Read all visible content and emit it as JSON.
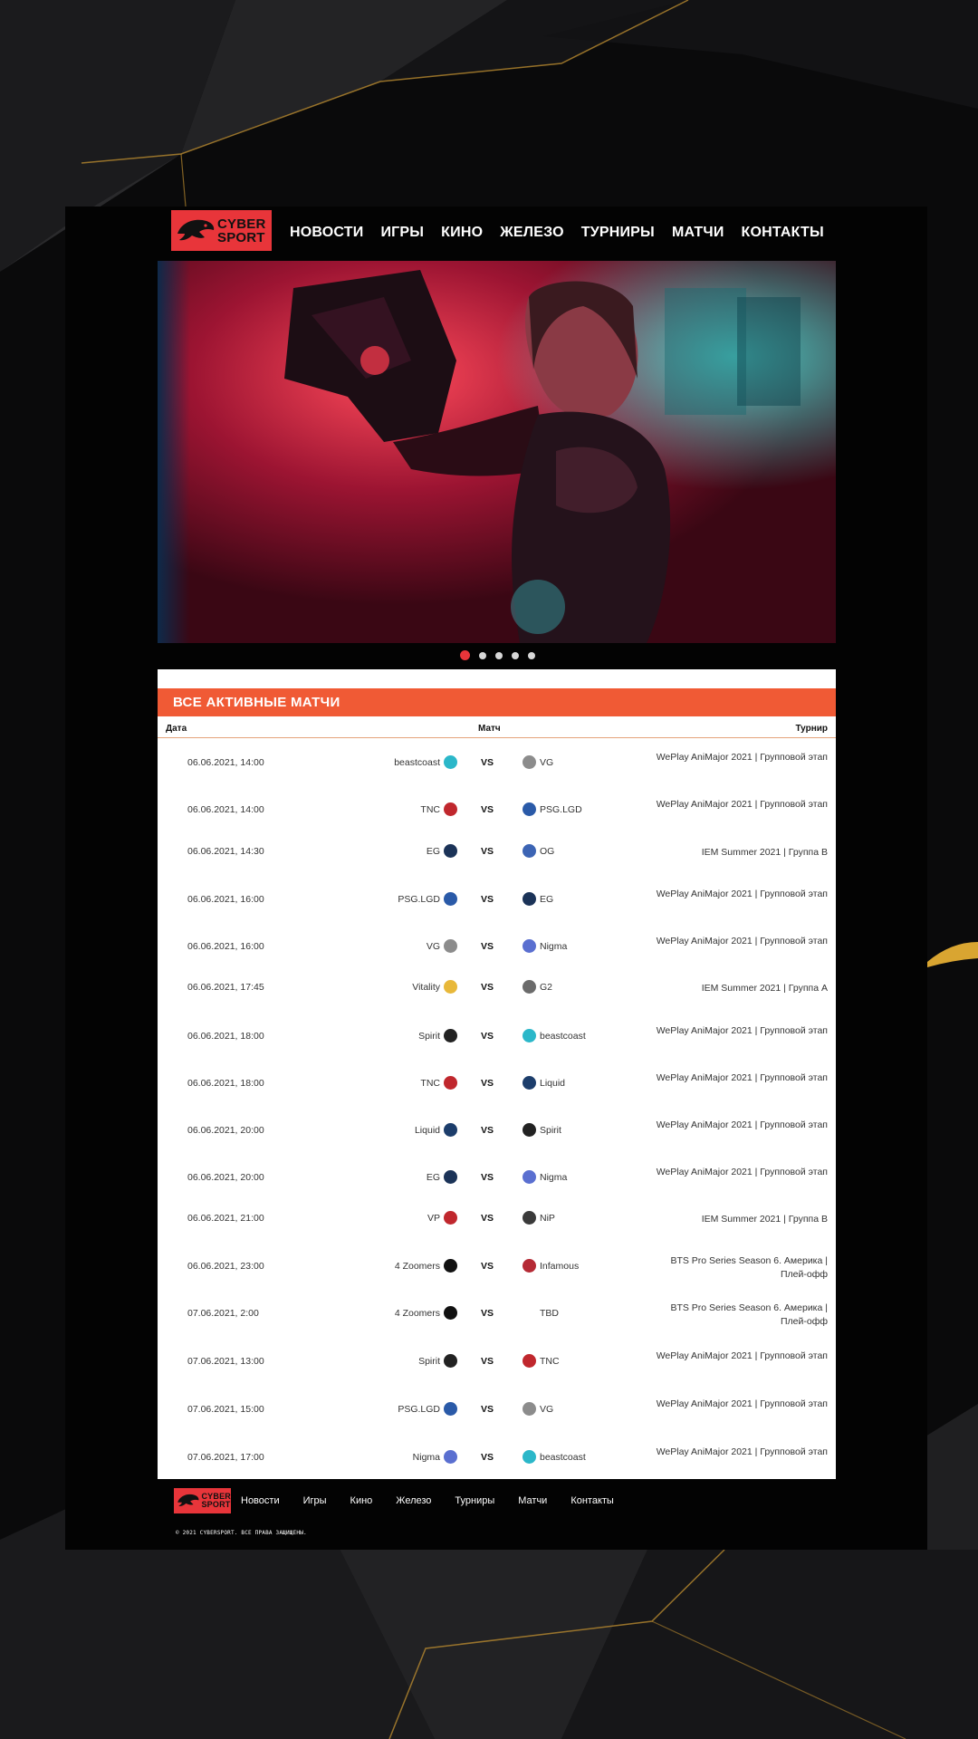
{
  "logo": {
    "line1": "CYBER",
    "line2": "SPORT"
  },
  "nav": [
    "НОВОСТИ",
    "ИГРЫ",
    "КИНО",
    "ЖЕЛЕЗО",
    "ТУРНИРЫ",
    "МАТЧИ",
    "КОНТАКТЫ"
  ],
  "carousel": {
    "slides": 5,
    "active": 1
  },
  "matches": {
    "title": "ВСЕ АКТИВНЫЕ МАТЧИ",
    "columns": {
      "date": "Дата",
      "match": "Матч",
      "tournament": "Турнир"
    },
    "vs": "VS",
    "rows": [
      {
        "date": "06.06.2021, 14:00",
        "home": "beastcoast",
        "away": "VG",
        "tournament": "WePlay AniMajor 2021 | Групповой этап"
      },
      {
        "date": "06.06.2021, 14:00",
        "home": "TNC",
        "away": "PSG.LGD",
        "tournament": "WePlay AniMajor 2021 | Групповой этап"
      },
      {
        "date": "06.06.2021, 14:30",
        "home": "EG",
        "away": "OG",
        "tournament": "IEM Summer 2021 | Группа B"
      },
      {
        "date": "06.06.2021, 16:00",
        "home": "PSG.LGD",
        "away": "EG",
        "tournament": "WePlay AniMajor 2021 | Групповой этап"
      },
      {
        "date": "06.06.2021, 16:00",
        "home": "VG",
        "away": "Nigma",
        "tournament": "WePlay AniMajor 2021 | Групповой этап"
      },
      {
        "date": "06.06.2021, 17:45",
        "home": "Vitality",
        "away": "G2",
        "tournament": "IEM Summer 2021 | Группа A"
      },
      {
        "date": "06.06.2021, 18:00",
        "home": "Spirit",
        "away": "beastcoast",
        "tournament": "WePlay AniMajor 2021 | Групповой этап"
      },
      {
        "date": "06.06.2021, 18:00",
        "home": "TNC",
        "away": "Liquid",
        "tournament": "WePlay AniMajor 2021 | Групповой этап"
      },
      {
        "date": "06.06.2021, 20:00",
        "home": "Liquid",
        "away": "Spirit",
        "tournament": "WePlay AniMajor 2021 | Групповой этап"
      },
      {
        "date": "06.06.2021, 20:00",
        "home": "EG",
        "away": "Nigma",
        "tournament": "WePlay AniMajor 2021 | Групповой этап"
      },
      {
        "date": "06.06.2021, 21:00",
        "home": "VP",
        "away": "NiP",
        "tournament": "IEM Summer 2021 | Группа B"
      },
      {
        "date": "06.06.2021, 23:00",
        "home": "4 Zoomers",
        "away": "Infamous",
        "tournament": "BTS Pro Series Season 6. Америка | Плей-офф"
      },
      {
        "date": "07.06.2021, 2:00",
        "home": "4 Zoomers",
        "away": "TBD",
        "tournament": "BTS Pro Series Season 6. Америка | Плей-офф"
      },
      {
        "date": "07.06.2021, 13:00",
        "home": "Spirit",
        "away": "TNC",
        "tournament": "WePlay AniMajor 2021 | Групповой этап"
      },
      {
        "date": "07.06.2021, 15:00",
        "home": "PSG.LGD",
        "away": "VG",
        "tournament": "WePlay AniMajor 2021 | Групповой этап"
      },
      {
        "date": "07.06.2021, 17:00",
        "home": "Nigma",
        "away": "beastcoast",
        "tournament": "WePlay AniMajor 2021 | Групповой этап"
      }
    ]
  },
  "team_colors": {
    "beastcoast": "#2bb7c9",
    "VG": "#8c8c8c",
    "TNC": "#c0272d",
    "PSG.LGD": "#2a5aa8",
    "EG": "#1b3358",
    "OG": "#3c64b4",
    "Nigma": "#5a6fd0",
    "Vitality": "#e8b83a",
    "G2": "#6b6b6b",
    "Spirit": "#222222",
    "Liquid": "#1c3d6b",
    "VP": "#c0272d",
    "NiP": "#3a3a3a",
    "4 Zoomers": "#111111",
    "Infamous": "#b52a35",
    "TBD": ""
  },
  "footer": {
    "nav": [
      "Новости",
      "Игры",
      "Кино",
      "Железо",
      "Турниры",
      "Матчи",
      "Контакты"
    ],
    "copyright": "© 2021 CYBERSPORT. ВСЕ ПРАВА ЗАЩИЩЕНЫ."
  },
  "colors": {
    "accent": "#e8353a",
    "panel_header": "#f05a35",
    "page": "#030303"
  }
}
